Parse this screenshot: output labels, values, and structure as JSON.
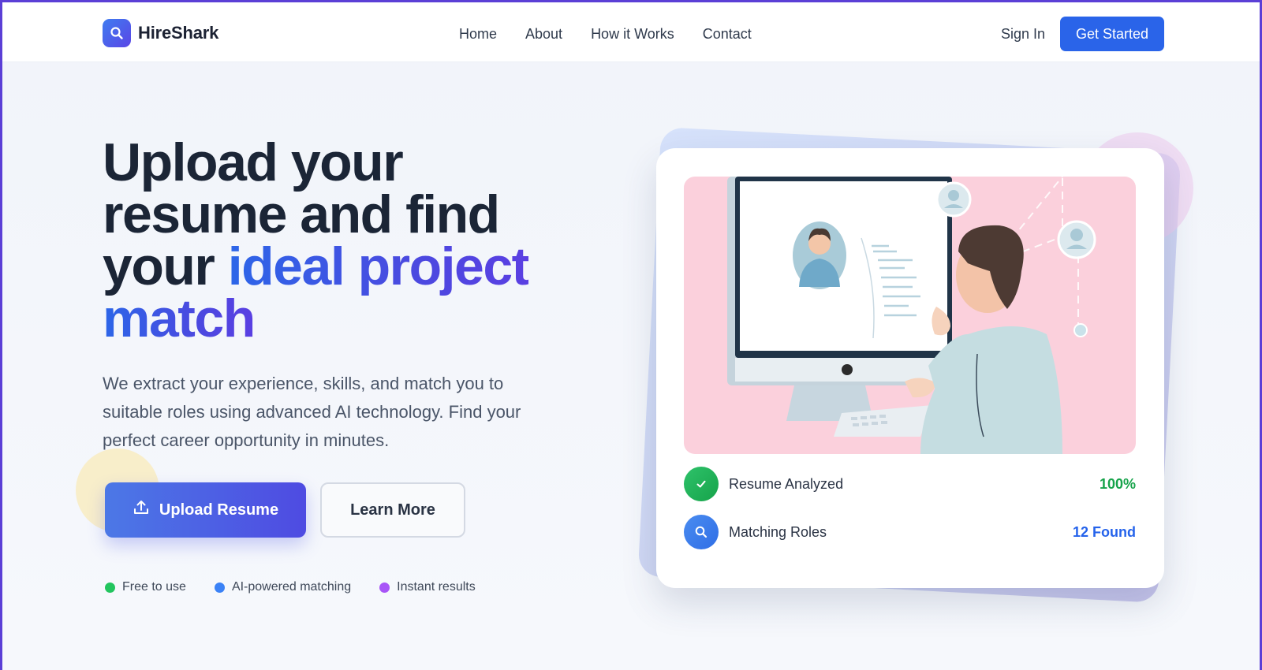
{
  "nav": {
    "brand": "HireShark",
    "links": [
      "Home",
      "About",
      "How it Works",
      "Contact"
    ],
    "sign_in": "Sign In",
    "get_started": "Get Started"
  },
  "hero": {
    "title_plain": "Upload your resume and find your ",
    "title_line1": "Upload your",
    "title_line2": "resume and find",
    "title_line3_plain": "your ",
    "title_highlight_1": "ideal project",
    "title_highlight_2": "match",
    "description": "We extract your experience, skills, and match you to suitable roles using advanced AI technology. Find your perfect career opportunity in minutes.",
    "upload_button": "Upload Resume",
    "learn_more_button": "Learn More",
    "features": [
      {
        "label": "Free to use",
        "color": "#22c55e"
      },
      {
        "label": "AI-powered matching",
        "color": "#3b82f6"
      },
      {
        "label": "Instant results",
        "color": "#a855f7"
      }
    ]
  },
  "card": {
    "status": [
      {
        "label": "Resume Analyzed",
        "value": "100%",
        "value_color": "#16a34a",
        "icon": "check-icon"
      },
      {
        "label": "Matching Roles",
        "value": "12 Found",
        "value_color": "#2563eb",
        "icon": "search-icon"
      }
    ]
  },
  "colors": {
    "primary": "#2a64e9",
    "accent_gradient_end": "#5a3fe2",
    "frame_border": "#5b3fd6"
  }
}
